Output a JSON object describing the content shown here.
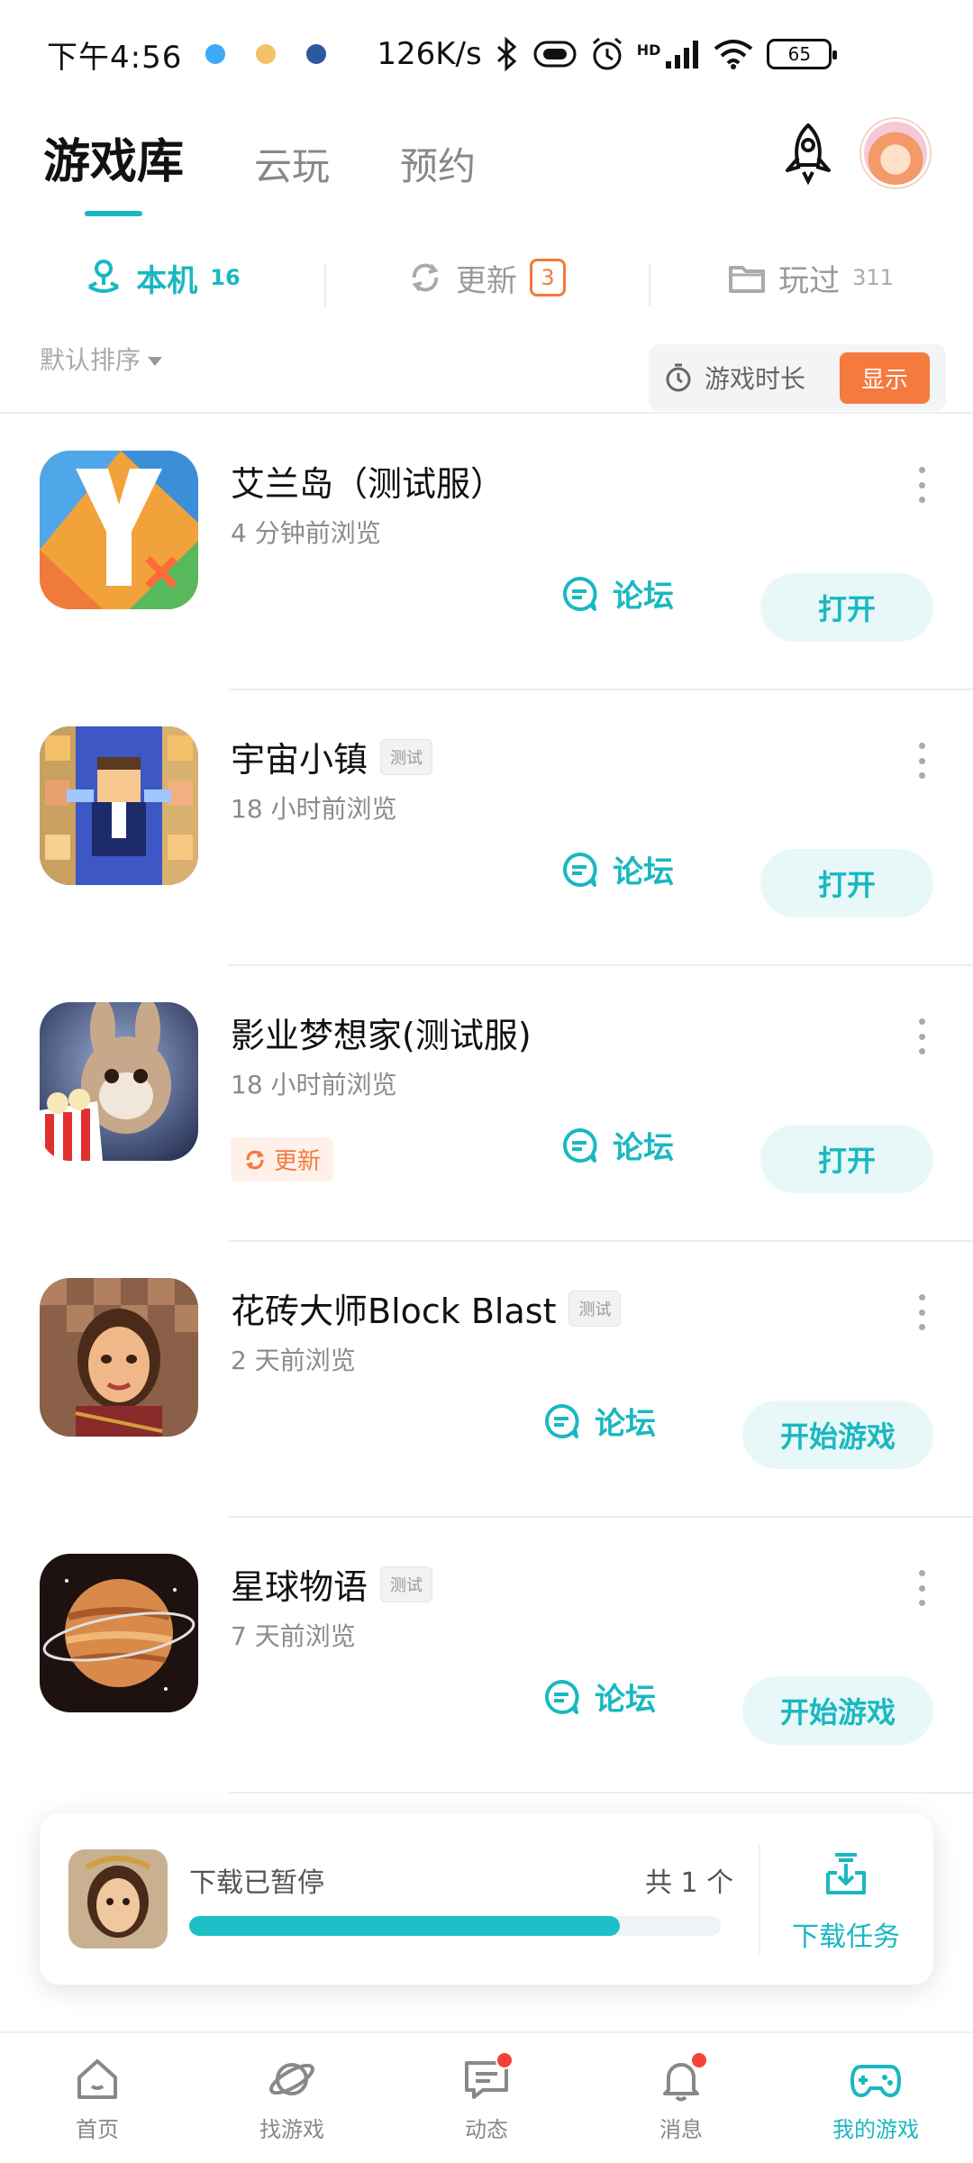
{
  "status_bar": {
    "time": "下午4:56",
    "net_speed": "126K/s",
    "battery": "65",
    "network_badge": "HD"
  },
  "top_tabs": [
    {
      "label": "游戏库",
      "active": true
    },
    {
      "label": "云玩",
      "active": false
    },
    {
      "label": "预约",
      "active": false
    }
  ],
  "sub_tabs": {
    "local": {
      "label": "本机",
      "count": "16"
    },
    "update": {
      "label": "更新",
      "count": "3"
    },
    "played": {
      "label": "玩过",
      "count": "311"
    }
  },
  "sort": {
    "label": "默认排序"
  },
  "playtime": {
    "label": "游戏时长",
    "button": "显示"
  },
  "games": [
    {
      "title": "艾兰岛（测试服）",
      "tag": "",
      "subtitle": "4 分钟前浏览",
      "forum": "论坛",
      "action": "打开",
      "update": ""
    },
    {
      "title": "宇宙小镇",
      "tag": "测试",
      "subtitle": "18 小时前浏览",
      "forum": "论坛",
      "action": "打开",
      "update": ""
    },
    {
      "title": "影业梦想家(测试服)",
      "tag": "",
      "subtitle": "18 小时前浏览",
      "forum": "论坛",
      "action": "打开",
      "update": "更新"
    },
    {
      "title": "花砖大师Block Blast",
      "tag": "测试",
      "subtitle": "2 天前浏览",
      "forum": "论坛",
      "action": "开始游戏",
      "update": ""
    },
    {
      "title": "星球物语",
      "tag": "测试",
      "subtitle": "7 天前浏览",
      "forum": "论坛",
      "action": "开始游戏",
      "update": ""
    }
  ],
  "download": {
    "status": "下载已暂停",
    "total": "共 1 个",
    "progress": 0.81,
    "task_label": "下载任务"
  },
  "bottom_nav": [
    {
      "label": "首页",
      "icon": "home-icon",
      "badge": false,
      "active": false
    },
    {
      "label": "找游戏",
      "icon": "planet-icon",
      "badge": false,
      "active": false
    },
    {
      "label": "动态",
      "icon": "chat-icon",
      "badge": true,
      "active": false
    },
    {
      "label": "消息",
      "icon": "bell-icon",
      "badge": true,
      "active": false
    },
    {
      "label": "我的游戏",
      "icon": "gamepad-icon",
      "badge": false,
      "active": true
    }
  ],
  "colors": {
    "accent": "#19b8c1",
    "orange": "#f47a3e",
    "badge_red": "#f44336"
  }
}
